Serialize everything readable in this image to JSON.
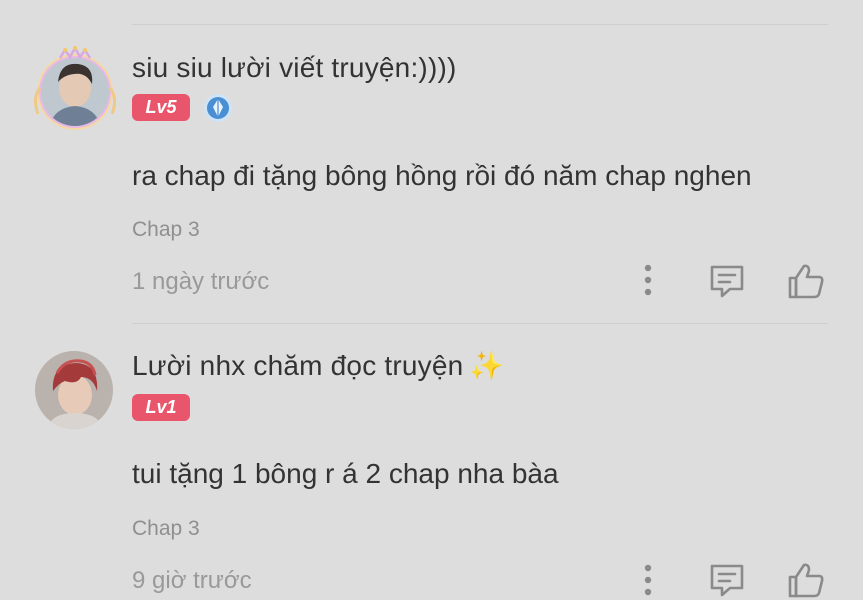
{
  "comments": [
    {
      "username": "siu siu lười viết truyện:))))",
      "level": "Lv5",
      "text": "ra chap đi tặng bông hồng rồi đó năm chap nghen",
      "chapter": "Chap 3",
      "time": "1 ngày trước",
      "icons": {
        "avatar": "avatar-with-crown-frame",
        "medal": "medal-badge-icon",
        "more": "more-vertical-icon",
        "reply": "reply-comment-icon",
        "like": "thumbs-up-icon"
      }
    },
    {
      "username": "Lười nhx chăm đọc truyện",
      "sparkle": "✨",
      "level": "Lv1",
      "text": "tui tặng 1 bông r á 2 chap nha bàa",
      "chapter": "Chap 3",
      "time": "9 giờ trước",
      "icons": {
        "avatar": "avatar",
        "more": "more-vertical-icon",
        "reply": "reply-comment-icon",
        "like": "thumbs-up-icon"
      }
    }
  ],
  "colors": {
    "background": "#dddddd",
    "level_badge": "#e9566c",
    "text_primary": "#333333",
    "text_secondary": "#999999",
    "icon": "#8a8a8a"
  }
}
